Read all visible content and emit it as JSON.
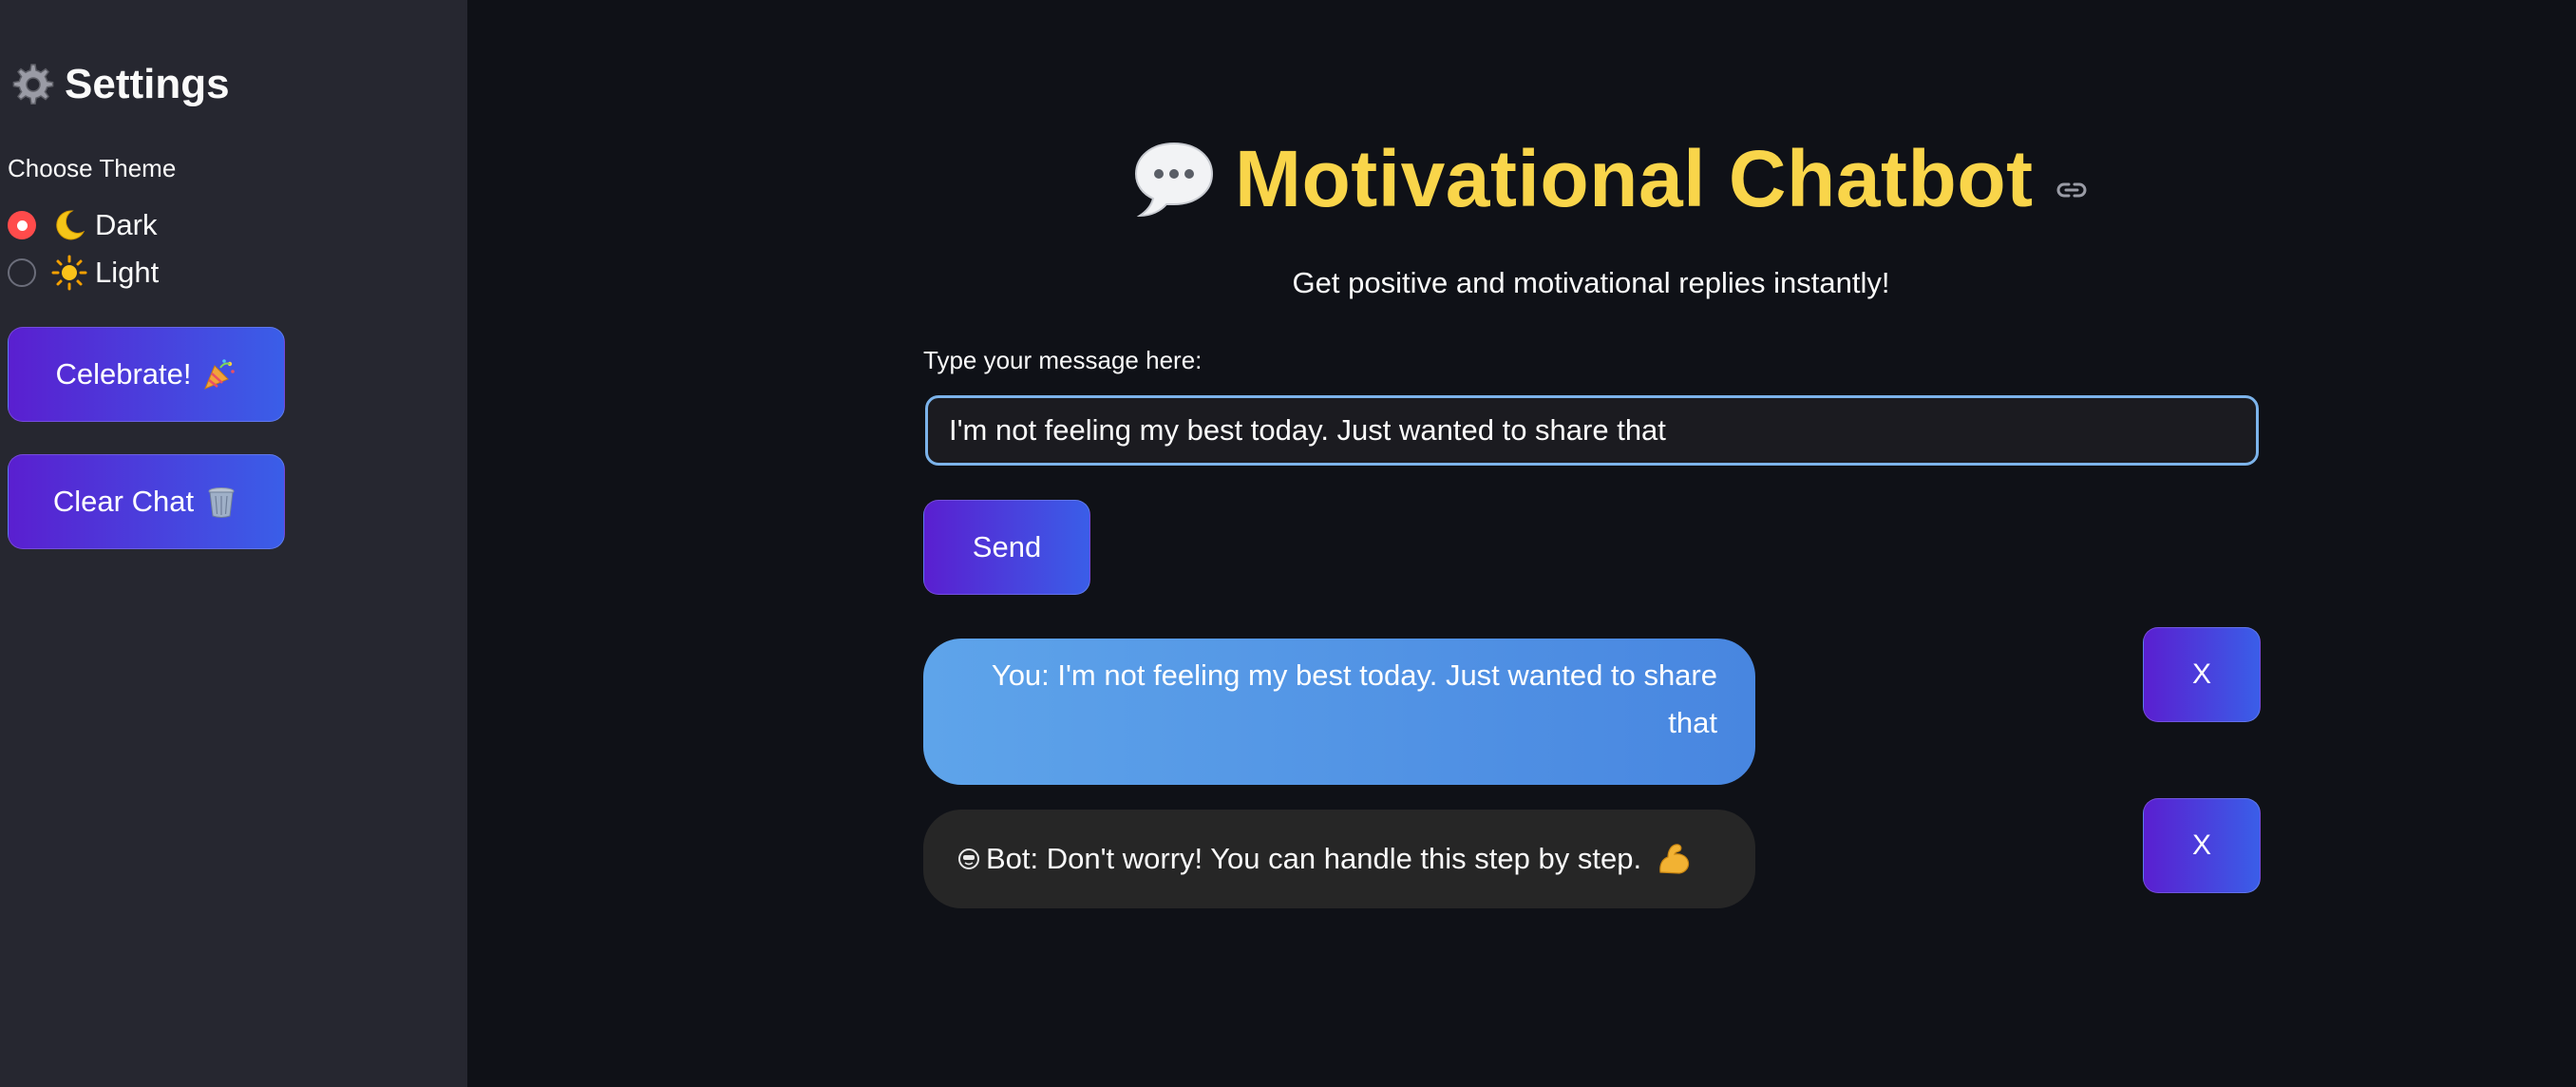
{
  "sidebar": {
    "title": "Settings",
    "gear_icon": "gear-icon",
    "theme_label": "Choose Theme",
    "theme_options": [
      {
        "label": "Dark",
        "icon": "moon-icon",
        "selected": true
      },
      {
        "label": "Light",
        "icon": "sun-icon",
        "selected": false
      }
    ],
    "celebrate_label": "Celebrate!",
    "celebrate_icon": "party-popper-icon",
    "clear_label": "Clear Chat",
    "clear_icon": "trash-icon"
  },
  "main": {
    "title": "Motivational Chatbot",
    "title_icon": "speech-bubble-icon",
    "subtitle": "Get positive and motivational replies instantly!",
    "input_label": "Type your message here:",
    "input_value": "I'm not feeling my best today. Just wanted to share that",
    "send_label": "Send"
  },
  "messages": [
    {
      "sender": "user",
      "text": "You: I'm not feeling my best today. Just wanted to share that",
      "remove_label": "X"
    },
    {
      "sender": "bot",
      "text": "Bot: Don't worry! You can handle this step by step.",
      "remove_label": "X"
    }
  ],
  "colors": {
    "background": "#0f1117",
    "sidebar": "#262730",
    "title": "#f9d54a",
    "button_gradient_start": "#5a1fd0",
    "button_gradient_end": "#3a5ee8",
    "user_bubble": "#5ea4ea",
    "bot_bubble": "#262626",
    "radio_selected": "#ff4b4b",
    "input_border": "#7cb3ea"
  }
}
